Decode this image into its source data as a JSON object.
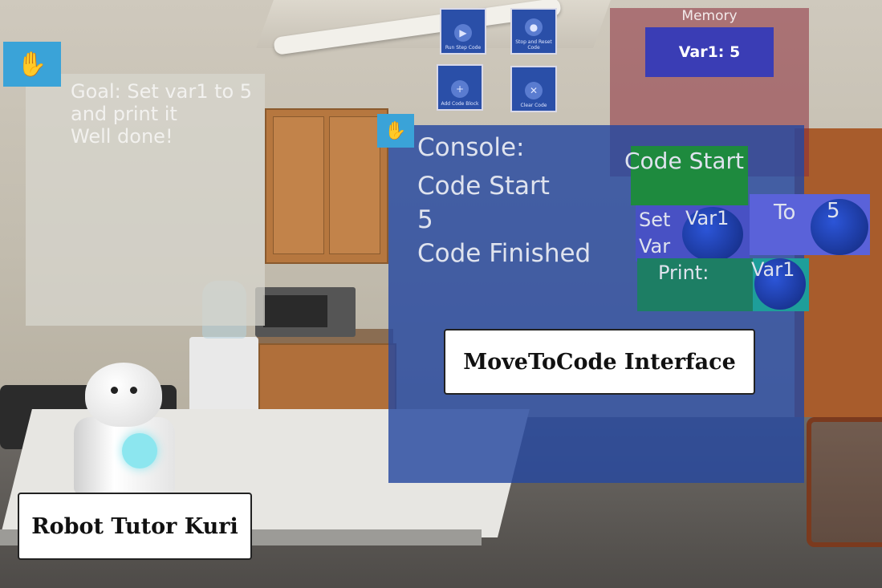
{
  "goal_panel": {
    "text": "Goal: Set var1 to 5\nand print it\nWell done!",
    "grab_icon": "hand-grab-icon"
  },
  "toolbar": {
    "buttons": [
      {
        "label": "Run Step Code",
        "icon": "run-step-icon"
      },
      {
        "label": "Stop and Reset Code",
        "icon": "stop-reset-icon"
      },
      {
        "label": "Add Code Block",
        "icon": "add-block-icon"
      },
      {
        "label": "Clear Code",
        "icon": "clear-icon"
      }
    ]
  },
  "memory": {
    "title": "Memory",
    "var_display": "Var1: 5"
  },
  "console": {
    "grab_icon": "hand-grab-icon",
    "lines": [
      "Console:",
      "Code Start",
      "5",
      "Code Finished"
    ]
  },
  "code_blocks": {
    "start": "Code Start",
    "set_var_label": "Set Var",
    "set_var_name": "Var1",
    "to_label": "To",
    "to_value": "5",
    "print_label": "Print:",
    "print_var": "Var1"
  },
  "callouts": {
    "interface": "MoveToCode Interface",
    "robot": "Robot Tutor Kuri"
  },
  "colors": {
    "console_bg": "#2648a0",
    "memory_bg": "#8c2c3a",
    "start_block": "#1e8a3e",
    "set_block": "#4851c4",
    "print_block": "#1d7e64",
    "grab_button": "#3aa3d8"
  }
}
